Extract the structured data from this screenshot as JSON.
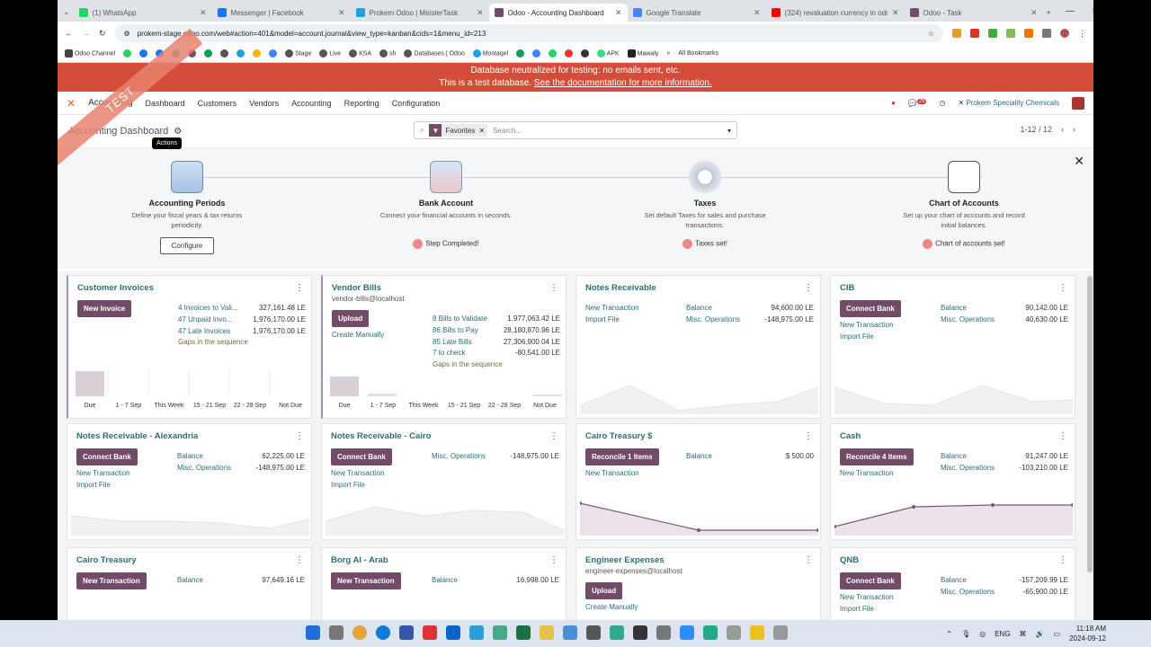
{
  "browser": {
    "tabs": [
      {
        "title": "(1) WhatsApp",
        "color": "#25d366"
      },
      {
        "title": "Messenger | Facebook",
        "color": "#1877f2"
      },
      {
        "title": "Prokem Odoo | MeisterTask",
        "color": "#1fa3e0"
      },
      {
        "title": "Odoo - Accounting Dashboard",
        "color": "#714b67",
        "active": true
      },
      {
        "title": "Google Translate",
        "color": "#4285f4"
      },
      {
        "title": "(324) revaluation currency in odoo",
        "color": "#ff0000"
      },
      {
        "title": "Odoo - Task",
        "color": "#714b67"
      }
    ],
    "url": "prokem-stage.odoo.com/web#action=401&model=account.journal&view_type=kanban&cids=1&menu_id=213",
    "bookmarks": [
      "Odoo Channel",
      "Stage",
      "Live",
      "KSA",
      "sh",
      "Databases | Odoo",
      "Mostaqel",
      "APK",
      "Mawaly"
    ],
    "all_bookmarks": "All Bookmarks"
  },
  "banner": {
    "line1": "Database neutralized for testing: no emails sent, etc.",
    "line2_prefix": "This is a test database.",
    "line2_link": "See the documentation for more information."
  },
  "ribbon": "TEST",
  "navbar": {
    "app": "Accounting",
    "menus": [
      "Dashboard",
      "Customers",
      "Vendors",
      "Accounting",
      "Reporting",
      "Configuration"
    ],
    "badge": "29",
    "company": "Prokem Speciality Chemicals"
  },
  "control": {
    "breadcrumb": "Accounting Dashboard",
    "tooltip": "Actions",
    "facet": "Favorites",
    "search_placeholder": "Search...",
    "pager": "1-12 / 12"
  },
  "onboarding": [
    {
      "title": "Accounting Periods",
      "desc": "Define your fiscal years & tax returns periodicity.",
      "button": "Configure"
    },
    {
      "title": "Bank Account",
      "desc": "Connect your financial accounts in seconds.",
      "done": "Step Completed!"
    },
    {
      "title": "Taxes",
      "desc": "Set default Taxes for sales and purchase transactions.",
      "done": "Taxes set!"
    },
    {
      "title": "Chart of Accounts",
      "desc": "Set up your chart of accounts and record initial balances.",
      "done": "Chart of accounts set!"
    }
  ],
  "cards": {
    "customer_invoices": {
      "title": "Customer Invoices",
      "button": "New Invoice",
      "stats": [
        [
          "4 Invoices to Vali...",
          "327,161.48 LE"
        ],
        [
          "47 Unpaid Invo...",
          "1,976,170.00 LE"
        ],
        [
          "47 Late Invoices",
          "1,976,170.00 LE"
        ]
      ],
      "gaps": "Gaps in the sequence",
      "bar_labels": [
        "Due",
        "1 - 7 Sep",
        "This Week",
        "15 - 21 Sep",
        "22 - 28 Sep",
        "Not Due"
      ]
    },
    "vendor_bills": {
      "title": "Vendor Bills",
      "sub": "vendor-bills@localhost",
      "button": "Upload",
      "link": "Create Manually",
      "stats": [
        [
          "8 Bills to Validate",
          "1,977,063.42 LE"
        ],
        [
          "86 Bills to Pay",
          "28,180,870.96 LE"
        ],
        [
          "85 Late Bills",
          "27,306,900.04 LE"
        ],
        [
          "7 to check",
          "-80,541.00 LE"
        ]
      ],
      "gaps": "Gaps in the sequence",
      "bar_labels": [
        "Due",
        "1 - 7 Sep",
        "This Week",
        "15 - 21 Sep",
        "22 - 28 Sep",
        "Not Due"
      ]
    },
    "notes_receivable": {
      "title": "Notes Receivable",
      "links": [
        "New Transaction",
        "Import File"
      ],
      "stats": [
        [
          "Balance",
          "94,600.00 LE"
        ],
        [
          "Misc. Operations",
          "-148,975.00 LE"
        ]
      ]
    },
    "cib": {
      "title": "CIB",
      "button": "Connect Bank",
      "links": [
        "New Transaction",
        "Import File"
      ],
      "stats": [
        [
          "Balance",
          "90,142.00 LE"
        ],
        [
          "Misc. Operations",
          "40,630.00 LE"
        ]
      ]
    },
    "nr_alex": {
      "title": "Notes Receivable - Alexandria",
      "button": "Connect Bank",
      "links": [
        "New Transaction",
        "Import File"
      ],
      "stats": [
        [
          "Balance",
          "62,225.00 LE"
        ],
        [
          "Misc. Operations",
          "-148,975.00 LE"
        ]
      ]
    },
    "nr_cairo": {
      "title": "Notes Receivable - Cairo",
      "button": "Connect Bank",
      "links": [
        "New Transaction",
        "Import File"
      ],
      "stats": [
        [
          "Misc. Operations",
          "-148,975.00 LE"
        ]
      ]
    },
    "cairo_treasury_usd": {
      "title": "Cairo Treasury $",
      "button": "Reconcile 1 Items",
      "links": [
        "New Transaction"
      ],
      "stats": [
        [
          "Balance",
          "$ 500.00"
        ]
      ]
    },
    "cash": {
      "title": "Cash",
      "button": "Reconcile 4 Items",
      "links": [
        "New Transaction"
      ],
      "stats": [
        [
          "Balance",
          "91,247.00 LE"
        ],
        [
          "Misc. Operations",
          "-103,210.00 LE"
        ]
      ]
    },
    "cairo_treasury": {
      "title": "Cairo Treasury",
      "button": "New Transaction",
      "stats": [
        [
          "Balance",
          "97,649.16 LE"
        ]
      ]
    },
    "borg_arab": {
      "title": "Borg Al - Arab",
      "button": "New Transaction",
      "stats": [
        [
          "Balance",
          "16,998.00 LE"
        ]
      ]
    },
    "engineer_expenses": {
      "title": "Engineer Expenses",
      "sub": "engineer-expenses@localhost",
      "button": "Upload",
      "links": [
        "Create Manually"
      ]
    },
    "qnb": {
      "title": "QNB",
      "button": "Connect Bank",
      "links": [
        "New Transaction",
        "Import File"
      ],
      "stats": [
        [
          "Balance",
          "-157,209.99 LE"
        ],
        [
          "Misc. Operations",
          "-65,900.00 LE"
        ]
      ]
    }
  },
  "taskbar": {
    "lang": "ENG",
    "time": "11:18 AM",
    "date": "2024-09-12"
  }
}
